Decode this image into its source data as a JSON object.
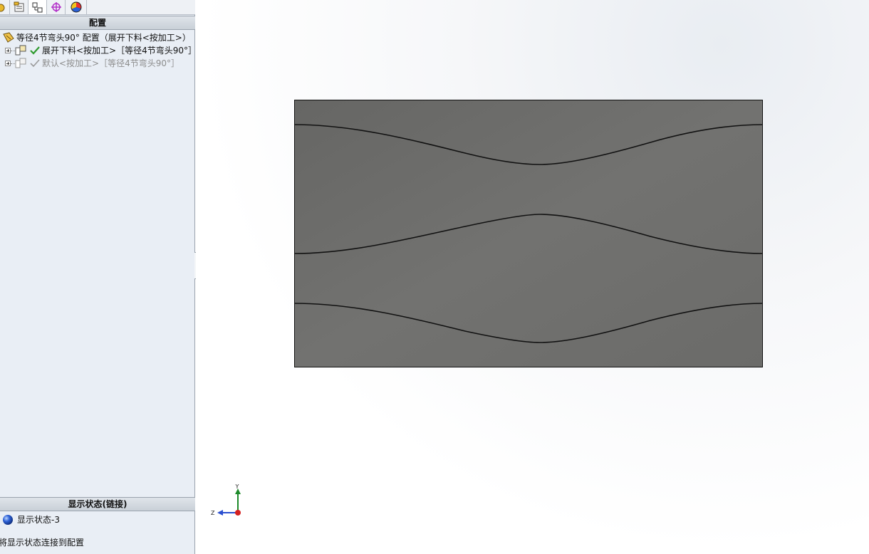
{
  "left_panel": {
    "tabs": [
      "feature-manager-icon",
      "property-manager-icon",
      "configuration-manager-icon",
      "dimxpert-icon",
      "display-manager-icon"
    ],
    "config_section": {
      "header": "配置",
      "root_label": "等径4节弯头90° 配置（展开下料<按加工>）",
      "items": [
        {
          "label": "展开下料<按加工>［等径4节弯头90°］",
          "active": true
        },
        {
          "label": "默认<按加工>［等径4节弯头90°］",
          "active": false
        }
      ]
    },
    "display_state_section": {
      "header": "显示状态(链接)",
      "state_label": "显示状态-3",
      "link_text": "将显示状态连接到配置"
    }
  },
  "graphics": {
    "triad": {
      "y_label": "Y",
      "z_label": "Z"
    },
    "colors": {
      "sheet_fill": "#6b6b69",
      "cut_line": "#111111",
      "check_green": "#2e9b2e"
    }
  }
}
